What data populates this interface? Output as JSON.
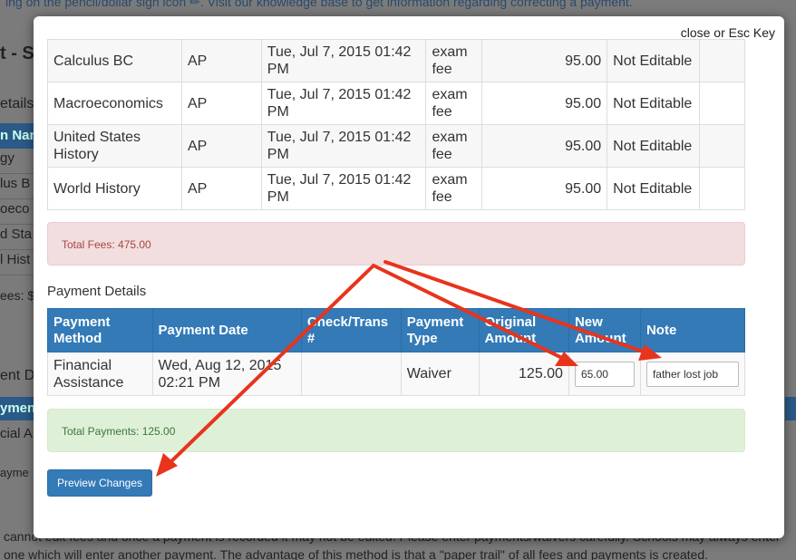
{
  "background": {
    "top_note": "ing on the pencil/dollar sign icon ✏. Visit our knowledge base to get information regarding correcting a payment.",
    "title": "t - S",
    "details_label": "etails",
    "table_header": "n Nan",
    "rows": [
      "gy",
      "lus B",
      "oeco",
      "d Sta",
      "l Hist"
    ],
    "fees": "ees: $",
    "payment_details": "ent De",
    "payment_header": "yment",
    "payment_row": "cial A",
    "payment_sub": "ayme",
    "bottom_line1": "cannot edit fees and once a payment is recorded it may not be edited. Please enter payments/waivers carefully. Schools may always enter",
    "bottom_line2": "one which will enter another payment. The advantage of this method is that a \"paper trail\" of all fees and payments is created."
  },
  "modal": {
    "close_label": "close or Esc Key",
    "fees": [
      {
        "course": "Calculus BC",
        "type": "AP",
        "date": "Tue, Jul 7, 2015 01:42 PM",
        "fee_type": "exam fee",
        "amount": "95.00",
        "status": "Not Editable"
      },
      {
        "course": "Macroeconomics",
        "type": "AP",
        "date": "Tue, Jul 7, 2015 01:42 PM",
        "fee_type": "exam fee",
        "amount": "95.00",
        "status": "Not Editable"
      },
      {
        "course": "United States History",
        "type": "AP",
        "date": "Tue, Jul 7, 2015 01:42 PM",
        "fee_type": "exam fee",
        "amount": "95.00",
        "status": "Not Editable"
      },
      {
        "course": "World History",
        "type": "AP",
        "date": "Tue, Jul 7, 2015 01:42 PM",
        "fee_type": "exam fee",
        "amount": "95.00",
        "status": "Not Editable"
      }
    ],
    "total_fees": "Total Fees: 475.00",
    "payment_details_label": "Payment Details",
    "payment_headers": {
      "method": "Payment Method",
      "date": "Payment Date",
      "check": "Check/Trans #",
      "type": "Payment Type",
      "original": "Original Amount",
      "new": "New Amount",
      "note": "Note"
    },
    "payment": {
      "method": "Financial Assistance",
      "date": "Wed, Aug 12, 2015 02:21 PM",
      "check": "",
      "type": "Waiver",
      "original": "125.00",
      "new_amount_value": "65.00",
      "note_value": "father lost job"
    },
    "total_payments": "Total Payments: 125.00",
    "preview_button": "Preview Changes"
  },
  "colors": {
    "primary": "#337ab7",
    "danger_bg": "#f2dede",
    "danger_text": "#a94442",
    "success_bg": "#dff0d8",
    "success_text": "#3c763d",
    "annotation_arrow": "#e8341c"
  }
}
